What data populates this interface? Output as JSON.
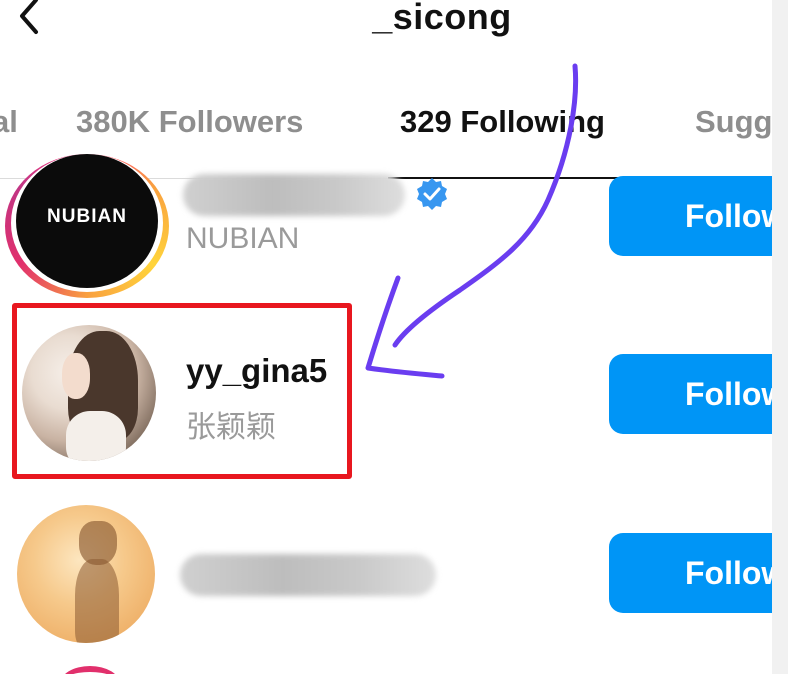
{
  "header": {
    "title": "_sicong",
    "back_icon": "chevron-left-icon"
  },
  "tabs": [
    {
      "label": "al",
      "active": false
    },
    {
      "label": "380K Followers",
      "active": false
    },
    {
      "label": "329 Following",
      "active": true
    },
    {
      "label": "Sugg",
      "active": false
    }
  ],
  "rows": [
    {
      "avatar_text": "NUBIAN",
      "username_obscured": true,
      "verified": true,
      "subtitle": "NUBIAN",
      "button_label": "Follow"
    },
    {
      "username": "yy_gina5",
      "subtitle": "张颖颖",
      "button_label": "Follow",
      "highlighted": true
    },
    {
      "username_obscured": true,
      "button_label": "Follow"
    }
  ],
  "colors": {
    "follow_button": "#0095f6",
    "highlight_box": "#e8171f",
    "annotation_arrow": "#6a3df0",
    "verified_badge": "#3897f0"
  }
}
